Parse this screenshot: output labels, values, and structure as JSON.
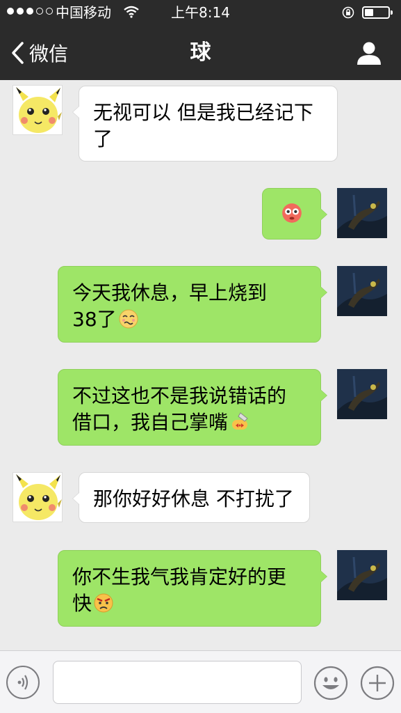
{
  "status_bar": {
    "carrier": "中国移动",
    "time": "上午8:14",
    "signal_dots_filled": 3,
    "signal_dots_total": 5
  },
  "nav": {
    "back_label": "微信",
    "title": "球"
  },
  "messages": [
    {
      "side": "in",
      "text": "无视可以 但是我已经记下了",
      "line1": "无视可以 但是我已经记下",
      "line2": "了",
      "emoji": ""
    },
    {
      "side": "out",
      "text": "",
      "emoji": "flushed-emoji"
    },
    {
      "side": "out",
      "line1": "今天我休息，早上烧到",
      "line2": "38了",
      "emoji": "sick-emoji"
    },
    {
      "side": "out",
      "line1": "不过这也不是我说错话的",
      "line2": "借口，我自己掌嘴",
      "emoji": "slap-emoji"
    },
    {
      "side": "in",
      "line1": "那你好好休息 不打扰了",
      "emoji": ""
    },
    {
      "side": "out",
      "line1": "你不生我气我肯定好的更",
      "line2": "快",
      "emoji": "angry-emoji"
    }
  ],
  "colors": {
    "header_bg": "#2b2b2b",
    "chat_bg": "#ebebeb",
    "bubble_out": "#9ee567",
    "bubble_in": "#ffffff"
  },
  "input_bar": {
    "voice_icon": "voice-icon",
    "emoji_icon": "smiley-icon",
    "more_icon": "plus-icon"
  }
}
